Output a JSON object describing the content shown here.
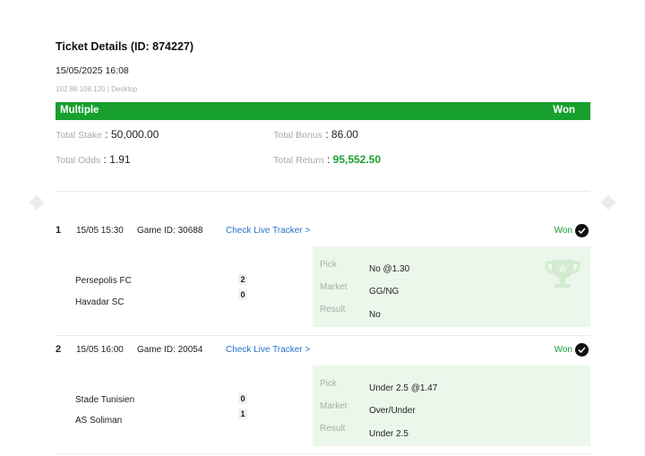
{
  "ticket": {
    "title": "Ticket Details (ID: 874227)",
    "datetime": "15/05/2025 16:08",
    "meta": "102.88.108.120 | Desktop",
    "type": "Multiple",
    "status": "Won"
  },
  "totals": {
    "stake_label": "Total Stake",
    "stake_value": "50,000.00",
    "bonus_label": "Total Bonus",
    "bonus_value": "86.00",
    "odds_label": "Total Odds",
    "odds_value": "1.91",
    "return_label": "Total Return",
    "return_value": "95,552.50"
  },
  "labels": {
    "pick": "Pick",
    "market": "Market",
    "result": "Result"
  },
  "selections": [
    {
      "index": "1",
      "datetime": "15/05 15:30",
      "game_id": "Game ID: 30688",
      "tracker": "Check Live Tracker >",
      "status": "Won",
      "home": "Persepolis FC",
      "away": "Havadar SC",
      "home_score": "2",
      "away_score": "0",
      "pick": "No @1.30",
      "market": "GG/NG",
      "result": "No"
    },
    {
      "index": "2",
      "datetime": "15/05 16:00",
      "game_id": "Game ID: 20054",
      "tracker": "Check Live Tracker >",
      "status": "Won",
      "home": "Stade Tunisien",
      "away": "AS Soliman",
      "home_score": "0",
      "away_score": "1",
      "pick": "Under 2.5 @1.47",
      "market": "Over/Under",
      "result": "Under 2.5"
    }
  ],
  "colors": {
    "accent": "#17a02d",
    "link": "#2b6fd1",
    "pick_bg": "#ebf7ea"
  },
  "icons": {
    "status": "check-circle-icon",
    "winner": "trophy-icon",
    "nav": "diamond-nav-icon"
  }
}
